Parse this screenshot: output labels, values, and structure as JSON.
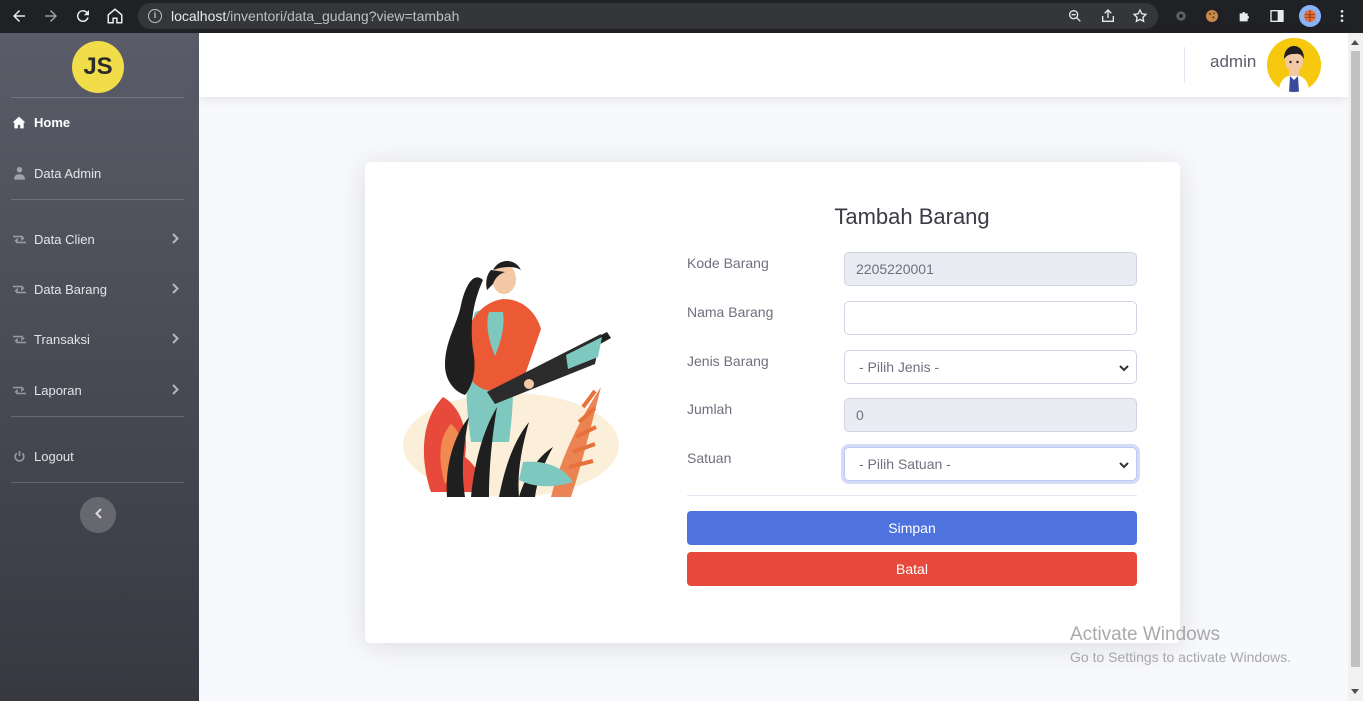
{
  "browser": {
    "url_host": "localhost",
    "url_path": "/inventori/data_gudang?view=tambah"
  },
  "sidebar": {
    "logo_text": "JS",
    "items": [
      {
        "label": "Home",
        "icon": "home-icon"
      },
      {
        "label": "Data Admin",
        "icon": "user-icon"
      },
      {
        "label": "Data Clien",
        "icon": "retweet-icon"
      },
      {
        "label": "Data Barang",
        "icon": "retweet-icon"
      },
      {
        "label": "Transaksi",
        "icon": "retweet-icon"
      },
      {
        "label": "Laporan",
        "icon": "retweet-icon"
      },
      {
        "label": "Logout",
        "icon": "power-icon"
      }
    ]
  },
  "topbar": {
    "username": "admin"
  },
  "form": {
    "title": "Tambah Barang",
    "kode_label": "Kode Barang",
    "kode_value": "2205220001",
    "nama_label": "Nama Barang",
    "nama_value": "",
    "jenis_label": "Jenis Barang",
    "jenis_selected": "- Pilih Jenis -",
    "jumlah_label": "Jumlah",
    "jumlah_value": "0",
    "satuan_label": "Satuan",
    "satuan_selected": "- Pilih Satuan -",
    "save_label": "Simpan",
    "cancel_label": "Batal"
  },
  "watermark": {
    "line1": "Activate Windows",
    "line2": "Go to Settings to activate Windows."
  },
  "colors": {
    "primary": "#4e73df",
    "danger": "#e74a3b",
    "sidebar_top": "#5a5c69",
    "sidebar_bottom": "#373840"
  }
}
